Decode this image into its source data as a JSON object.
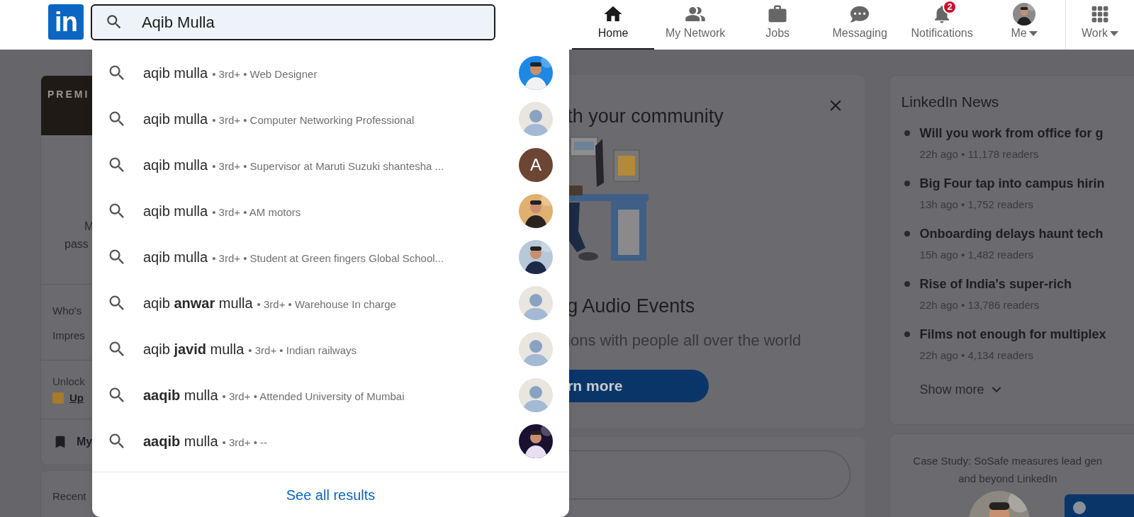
{
  "nav": {
    "logo": "in",
    "search": {
      "value": "Aqib Mulla"
    },
    "items": [
      {
        "kind": "home",
        "label": "Home",
        "selected": true
      },
      {
        "kind": "network",
        "label": "My Network",
        "selected": false
      },
      {
        "kind": "jobs",
        "label": "Jobs",
        "selected": false
      },
      {
        "kind": "messaging",
        "label": "Messaging",
        "selected": false
      },
      {
        "kind": "notifications",
        "label": "Notifications",
        "selected": false,
        "badge": "2"
      },
      {
        "kind": "me",
        "label": "Me",
        "selected": false,
        "has_menu": true
      }
    ],
    "work": {
      "label": "Work",
      "has_menu": true
    }
  },
  "left_column": {
    "premium_banner": "PREMI",
    "profile_lines": [
      "M",
      "pass"
    ],
    "stats": [
      "Who's",
      "Impres"
    ],
    "unlock": "Unlock",
    "upgrade_link": "Up",
    "saved": "My",
    "recent": "Recent"
  },
  "community_card": {
    "heading": "th your community",
    "title": "g Audio Events",
    "subtitle": "ions with people all over the world",
    "button": "rn more"
  },
  "news": {
    "title": "LinkedIn News",
    "items": [
      {
        "title": "Will you work from office for g",
        "meta": "22h ago • 11,178 readers"
      },
      {
        "title": "Big Four tap into campus hirin",
        "meta": "13h ago • 1,752 readers"
      },
      {
        "title": "Onboarding delays haunt tech",
        "meta": "15h ago • 1,482 readers"
      },
      {
        "title": "Rise of India's super-rich",
        "meta": "22h ago • 13,786 readers"
      },
      {
        "title": "Films not enough for multiplex",
        "meta": "22h ago • 4,134 readers"
      }
    ],
    "show_more": "Show more"
  },
  "ad": {
    "lines": [
      "Case Study: SoSafe measures lead gen",
      "and beyond LinkedIn"
    ]
  },
  "suggestions": [
    {
      "name": "aqib mulla",
      "meta": "• 3rd+ • Web Designer"
    },
    {
      "name": "aqib mulla",
      "meta": "• 3rd+ • Computer Networking Professional",
      "avatar": {
        "kind": "default"
      }
    },
    {
      "name": "aqib mulla",
      "meta": "• 3rd+ • Supervisor at Maruti Suzuki shantesha ...",
      "avatar": {
        "kind": "letter",
        "letter": "A"
      }
    },
    {
      "name": "aqib mulla",
      "meta": "• 3rd+ • AM motors"
    },
    {
      "name": "aqib mulla",
      "meta": "• 3rd+ • Student at Green fingers Global School..."
    },
    {
      "name": "aqib **anwar** mulla",
      "meta": "• 3rd+ • Warehouse In charge",
      "avatar": {
        "kind": "default"
      }
    },
    {
      "name": "aqib **javid** mulla",
      "meta": "• 3rd+ • Indian railways",
      "avatar": {
        "kind": "default"
      }
    },
    {
      "name": "**aaqib** mulla",
      "meta": "• 3rd+ • Attended University of Mumbai",
      "avatar": {
        "kind": "default"
      }
    },
    {
      "name": "**aaqib** mulla",
      "meta": "• 3rd+ • --"
    }
  ],
  "see_all": "See all results"
}
